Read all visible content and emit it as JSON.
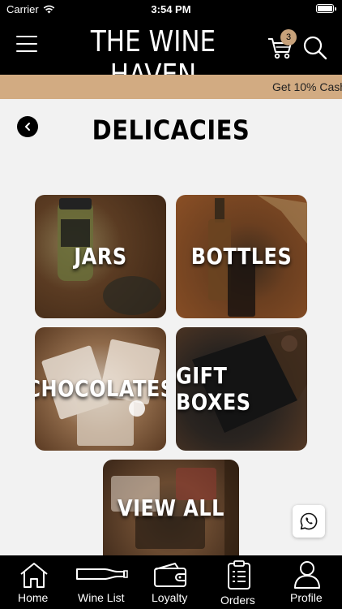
{
  "status": {
    "carrier": "Carrier",
    "time": "3:54 PM"
  },
  "header": {
    "brand": "THE WINE HAVEN",
    "cart_count": "3"
  },
  "promo": {
    "text": "Get 10% Cash"
  },
  "page": {
    "title": "DELICACIES"
  },
  "tiles": [
    {
      "label": "JARS"
    },
    {
      "label": "BOTTLES"
    },
    {
      "label": "CHOCOLATES"
    },
    {
      "label": "GIFT BOXES"
    },
    {
      "label": "VIEW ALL"
    }
  ],
  "nav": [
    {
      "label": "Home",
      "icon": "home-icon"
    },
    {
      "label": "Wine List",
      "icon": "bottle-icon"
    },
    {
      "label": "Loyalty",
      "icon": "wallet-icon"
    },
    {
      "label": "Orders",
      "icon": "clipboard-icon"
    },
    {
      "label": "Profile",
      "icon": "user-icon"
    }
  ],
  "colors": {
    "accent": "#d2ab82",
    "badge": "#c7a17a",
    "bar": "#000000"
  }
}
